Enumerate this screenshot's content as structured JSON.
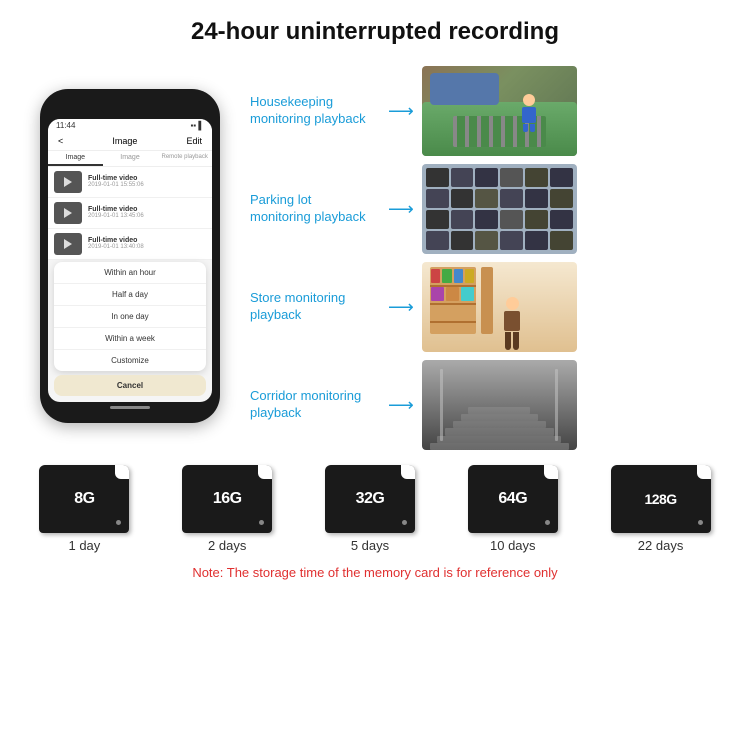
{
  "header": {
    "title": "24-hour uninterrupted recording"
  },
  "phone": {
    "time": "11:44",
    "nav": {
      "back": "<",
      "title": "Image",
      "edit": "Edit"
    },
    "tabs": [
      "Image",
      "Image",
      "Remote playback"
    ],
    "list_items": [
      {
        "title": "Full-time video",
        "date": "2019-01-01 15:55:06"
      },
      {
        "title": "Full-time video",
        "date": "2019-01-01 13:45:06"
      },
      {
        "title": "Full-time video",
        "date": "2019-01-01 13:40:08"
      }
    ],
    "dropdown_items": [
      "Within an hour",
      "Half a day",
      "In one day",
      "Within a week",
      "Customize"
    ],
    "cancel_label": "Cancel"
  },
  "monitoring": [
    {
      "label": "Housekeeping\nmonitoring playback",
      "img_type": "housekeeping"
    },
    {
      "label": "Parking lot\nmonitoring playback",
      "img_type": "parking"
    },
    {
      "label": "Store monitoring\nplayback",
      "img_type": "store"
    },
    {
      "label": "Corridor monitoring\nplayback",
      "img_type": "corridor"
    }
  ],
  "storage_cards": [
    {
      "capacity": "8G",
      "days": "1 day"
    },
    {
      "capacity": "16G",
      "days": "2 days"
    },
    {
      "capacity": "32G",
      "days": "5 days"
    },
    {
      "capacity": "64G",
      "days": "10 days"
    },
    {
      "capacity": "128G",
      "days": "22 days"
    }
  ],
  "note": "Note: The storage time of the memory card is for reference only"
}
